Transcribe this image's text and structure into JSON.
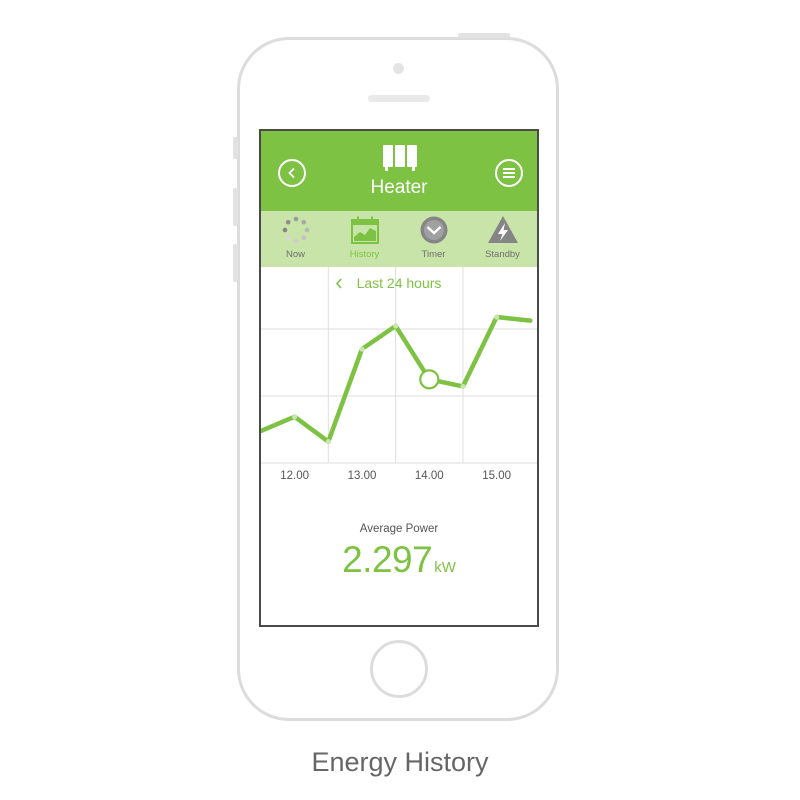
{
  "header": {
    "title": "Heater",
    "back_icon": "chevron-left-icon",
    "menu_icon": "menu-icon",
    "app_icon": "heater-icon"
  },
  "tabs": [
    {
      "label": "Now",
      "icon": "loading-dots-icon",
      "active": false
    },
    {
      "label": "History",
      "icon": "calendar-chart-icon",
      "active": true
    },
    {
      "label": "Timer",
      "icon": "clock-icon",
      "active": false
    },
    {
      "label": "Standby",
      "icon": "warning-bolt-icon",
      "active": false
    }
  ],
  "period": {
    "label": "Last 24 hours"
  },
  "chart_data": {
    "type": "line",
    "x_ticks": [
      "12.00",
      "13.00",
      "14.00",
      "15.00"
    ],
    "x": [
      11.5,
      12.0,
      12.5,
      13.0,
      13.5,
      14.0,
      14.5,
      15.0,
      15.5
    ],
    "values": [
      0.18,
      0.26,
      0.12,
      0.64,
      0.77,
      0.47,
      0.43,
      0.82,
      0.8
    ],
    "selected_index": 5,
    "xlim": [
      11.5,
      15.6
    ],
    "ylim": [
      0,
      1
    ],
    "grid": true
  },
  "summary": {
    "label": "Average Power",
    "value": "2.297",
    "unit": "kW"
  },
  "caption": "Energy History",
  "colors": {
    "accent": "#7dc242",
    "tab_bar": "#c8e4a8",
    "icon_gray": "#8a8a8a"
  }
}
